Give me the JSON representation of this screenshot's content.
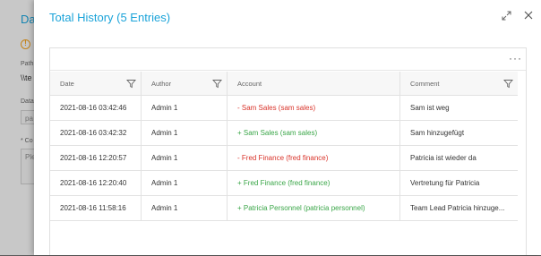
{
  "background": {
    "title": "Da",
    "path_label": "Path",
    "path_value": "\\\\te",
    "data_label": "Data",
    "data_value": "pa",
    "comment_label": "* Co",
    "comment_placeholder": "Ple"
  },
  "modal": {
    "title": "Total History (5 Entries)"
  },
  "table": {
    "headers": {
      "date": "Date",
      "author": "Author",
      "account": "Account",
      "comment": "Comment"
    },
    "rows": [
      {
        "date": "2021-08-16 03:42:46",
        "author": "Admin 1",
        "account": "- Sam Sales (sam sales)",
        "kind": "removed",
        "comment": "Sam ist weg"
      },
      {
        "date": "2021-08-16 03:42:32",
        "author": "Admin 1",
        "account": "+ Sam Sales (sam sales)",
        "kind": "added",
        "comment": "Sam hinzugefügt"
      },
      {
        "date": "2021-08-16 12:20:57",
        "author": "Admin 1",
        "account": "- Fred Finance (fred finance)",
        "kind": "removed",
        "comment": "Patricia ist wieder da"
      },
      {
        "date": "2021-08-16 12:20:40",
        "author": "Admin 1",
        "account": "+ Fred Finance (fred finance)",
        "kind": "added",
        "comment": "Vertretung für Patricia"
      },
      {
        "date": "2021-08-16 11:58:16",
        "author": "Admin 1",
        "account": "+ Patricia Personnel (patricia personnel)",
        "kind": "added",
        "comment": "Team Lead Patricia hinzuge..."
      }
    ]
  },
  "colors": {
    "accent": "#1aa3d9",
    "removed": "#d9342b",
    "added": "#3aa648"
  },
  "icons": {
    "expand": "expand-icon",
    "close": "close-icon",
    "more": "more-icon",
    "filter": "filter-icon"
  }
}
